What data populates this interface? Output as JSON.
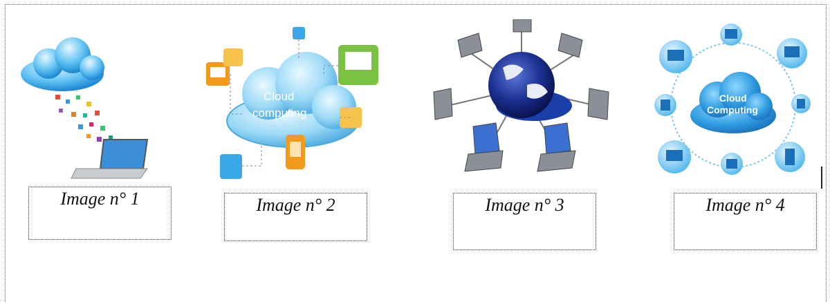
{
  "captions": [
    "Image n° 1",
    "Image n° 2",
    "Image n° 3",
    "Image n° 4"
  ],
  "cloud_text_image2": [
    "Cloud",
    "computing"
  ],
  "cloud_text_image4": [
    "Cloud",
    "Computing"
  ],
  "colors": {
    "frame_border": "#6a6a6a",
    "cloud_blue": "#3aa7e6",
    "cloud_light": "#cfeefe",
    "orange": "#f39a1e",
    "green": "#7cc242",
    "globe_blue": "#1b2f8f",
    "laptop_gray": "#8a8f98"
  }
}
